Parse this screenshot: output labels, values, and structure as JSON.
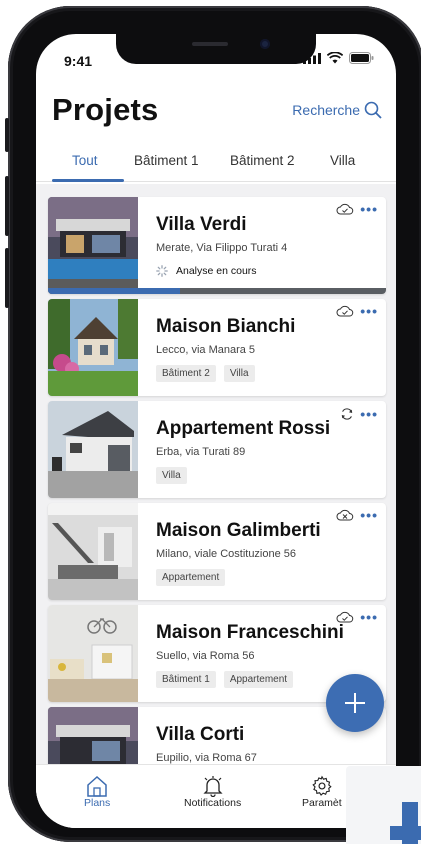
{
  "status_bar": {
    "time": "9:41"
  },
  "header": {
    "title": "Projets",
    "search_label": "Recherche"
  },
  "tabs": [
    {
      "label": "Tout",
      "active": true
    },
    {
      "label": "Bâtiment 1",
      "active": false
    },
    {
      "label": "Bâtiment 2",
      "active": false
    },
    {
      "label": "Villa",
      "active": false
    }
  ],
  "projects": [
    {
      "title": "Villa Verdi",
      "address": "Merate, Via Filippo Turati 4",
      "status": "Analyse en cours",
      "progress": 0.39,
      "sync_icon": "cloud-check-icon",
      "tags": []
    },
    {
      "title": "Maison Bianchi",
      "address": "Lecco, via Manara 5",
      "sync_icon": "cloud-check-icon",
      "tags": [
        "Bâtiment 2",
        "Villa"
      ]
    },
    {
      "title": "Appartement  Rossi",
      "address": "Erba, via Turati 89",
      "sync_icon": "sync-icon",
      "tags": [
        "Villa"
      ]
    },
    {
      "title": "Maison Galimberti",
      "address": "Milano,  viale Costituzione 56",
      "sync_icon": "cloud-off-icon",
      "tags": [
        "Appartement"
      ]
    },
    {
      "title": "Maison Franceschini",
      "address": "Suello, via Roma 56",
      "sync_icon": "cloud-check-icon",
      "tags": [
        "Bâtiment 1",
        "Appartement"
      ]
    },
    {
      "title": "Villa Corti",
      "address": "Eupilio, via Roma 67",
      "sync_icon": "cloud-check-icon",
      "tags": []
    }
  ],
  "bottom_nav": {
    "plans": "Plans",
    "notifications": "Notifications",
    "settings": "Paramèt"
  },
  "colors": {
    "accent": "#3b6bb0",
    "fab": "#3d6db3",
    "progress_track": "#5a5e63"
  }
}
